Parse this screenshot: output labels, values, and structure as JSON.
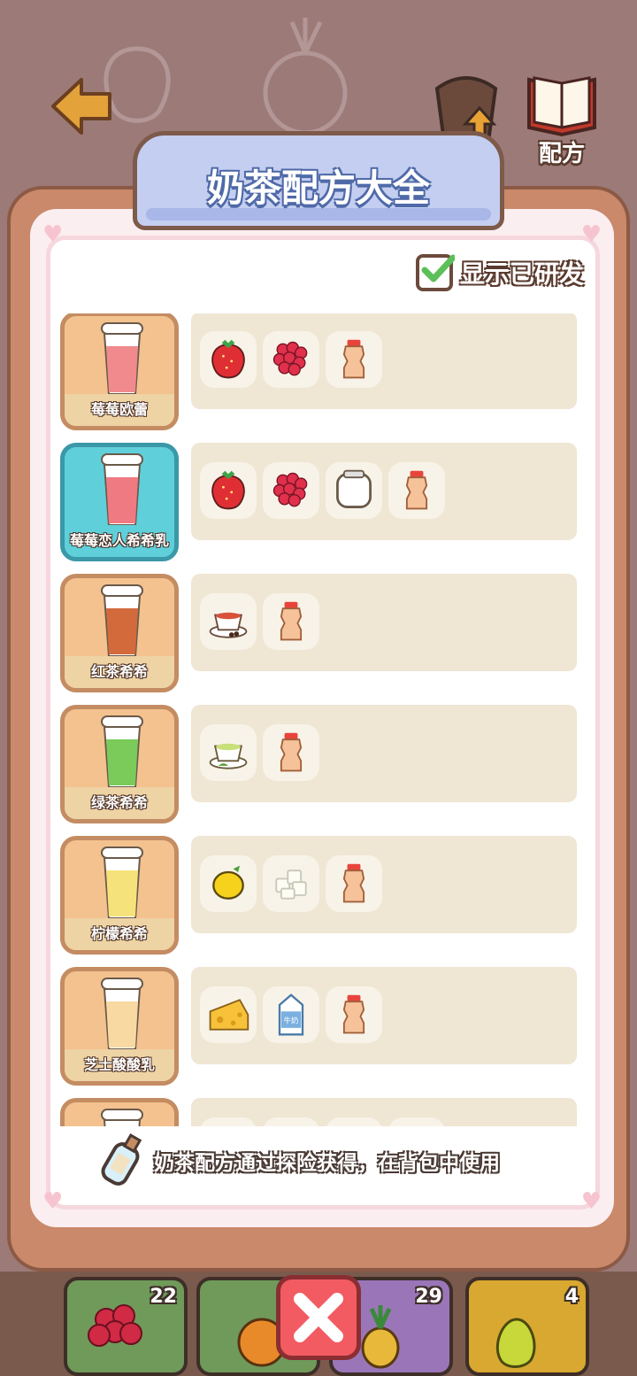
{
  "header": {
    "title": "奶茶配方大全",
    "upgrade_label": "升级",
    "recipe_label": "配方"
  },
  "filter": {
    "label": "显示已研发",
    "checked": true
  },
  "recipes": [
    {
      "name": "莓莓欧蕾",
      "liquid": "#f08a8c",
      "ingredients": [
        "strawberry-icon",
        "raspberry-icon",
        "yakult-icon"
      ]
    },
    {
      "name": "莓莓恋人希希乳",
      "liquid": "#f07a82",
      "selected": true,
      "ingredients": [
        "strawberry-icon",
        "raspberry-icon",
        "jar-icon",
        "yakult-icon"
      ]
    },
    {
      "name": "红茶希希",
      "liquid": "#d26a3c",
      "ingredients": [
        "black-tea-icon",
        "yakult-icon"
      ]
    },
    {
      "name": "绿茶希希",
      "liquid": "#7acb5a",
      "ingredients": [
        "green-tea-icon",
        "yakult-icon"
      ]
    },
    {
      "name": "柠檬希希",
      "liquid": "#f6e27a",
      "ingredients": [
        "lemon-icon",
        "sugar-cube-icon",
        "yakult-icon"
      ]
    },
    {
      "name": "芝士酸酸乳",
      "liquid": "#f8d9a2",
      "ingredients": [
        "cheese-icon",
        "milk-carton-icon",
        "yakult-icon"
      ]
    },
    {
      "name": "",
      "liquid": "#e8d8c8",
      "ingredients": [
        "slot-icon",
        "slot-icon",
        "slot-icon",
        "slot-icon"
      ]
    }
  ],
  "hint": "奶茶配方通过探险获得，在背包中使用",
  "inventory": [
    {
      "item": "raspberry-icon",
      "count": "22",
      "color": "#6f9a5a"
    },
    {
      "item": "orange-icon",
      "count": "",
      "color": "#6f9a5a"
    },
    {
      "item": "pineapple-icon",
      "count": "29",
      "color": "#9a76b8"
    },
    {
      "item": "pear-icon",
      "count": "4",
      "color": "#d8a830"
    }
  ],
  "colors": {
    "accent": "#c4cef0",
    "close": "#f25b62"
  }
}
